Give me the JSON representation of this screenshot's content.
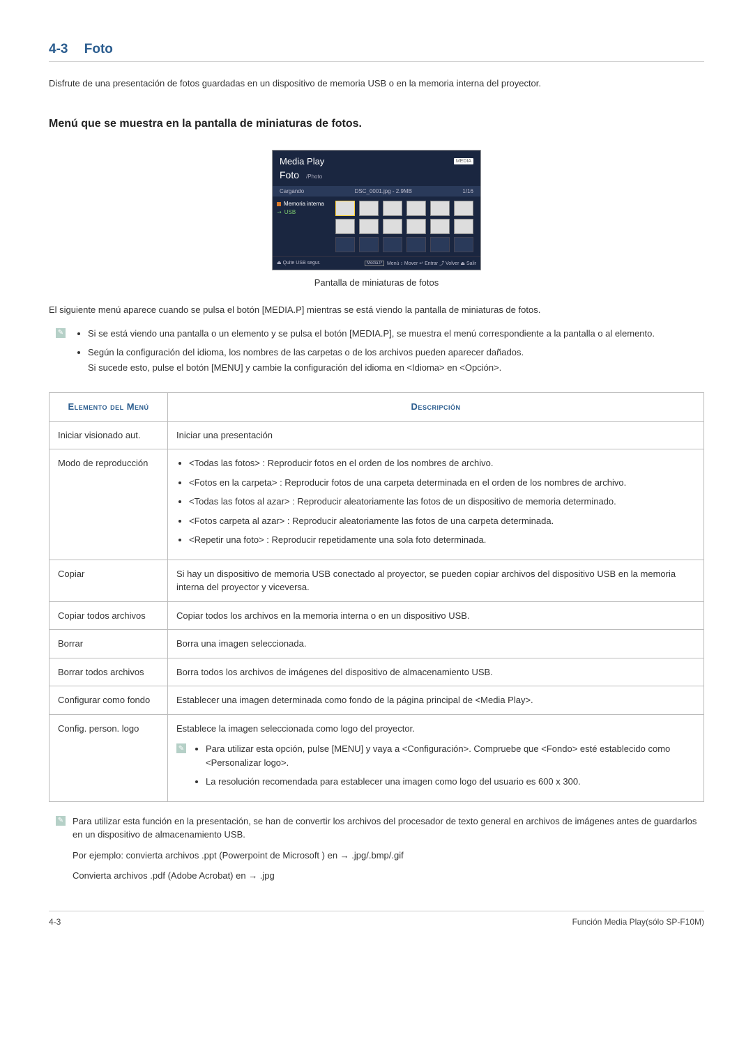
{
  "heading": {
    "num": "4-3",
    "title": "Foto"
  },
  "intro": "Disfrute de una presentación de fotos guardadas en un dispositivo de memoria USB o en la memoria interna del proyector.",
  "sub1": "Menú que se muestra en la pantalla de miniaturas de fotos.",
  "figure": {
    "title": "Media Play",
    "subtitle": "Foto",
    "path": "/Photo",
    "logo": "MEDIA",
    "status_left": "Cargando",
    "status_file": "DSC_0001.jpg - 2.9MB",
    "status_count": "1/16",
    "side_internal": "Memoria interna",
    "side_usb": "USB",
    "footer_left": "Quite USB segur.",
    "footer_mediap": "Media.P",
    "footer_right": "Menú  ↕ Mover  ↵ Entrar  ⤴ Volver  ⏏ Salir",
    "caption": "Pantalla de miniaturas de fotos"
  },
  "after_figure": "El siguiente menú aparece cuando se pulsa el botón [MEDIA.P] mientras se está viendo la pantalla de miniaturas de fotos.",
  "note1": {
    "b1": "Si se está viendo una pantalla o un elemento y se pulsa el botón [MEDIA.P], se muestra el menú correspondiente a la pantalla o al elemento.",
    "b2a": "Según la configuración del idioma, los nombres de las carpetas o de los archivos pueden aparecer dañados.",
    "b2b": "Si sucede esto, pulse el botón [MENU] y cambie la configuración del idioma en <Idioma> en <Opción>."
  },
  "table": {
    "h1": "Elemento del Menú",
    "h2": "Descripción",
    "r1_label": "Iniciar visionado aut.",
    "r1_desc": "Iniciar una presentación",
    "r2_label": "Modo de reproducción",
    "r2_b1": "<Todas las fotos> : Reproducir fotos en el orden de los nombres de archivo.",
    "r2_b2": "<Fotos en la carpeta> : Reproducir fotos de una carpeta determinada en el orden de los nombres de archivo.",
    "r2_b3": "<Todas las fotos al azar> : Reproducir aleatoriamente las fotos de un dispositivo de memoria determinado.",
    "r2_b4": "<Fotos carpeta al azar> : Reproducir aleatoriamente las fotos de una carpeta determinada.",
    "r2_b5": "<Repetir una foto> : Reproducir repetidamente una sola foto determinada.",
    "r3_label": "Copiar",
    "r3_desc": "Si hay un dispositivo de memoria USB conectado al proyector, se pueden copiar archivos del dispositivo USB en la memoria interna del proyector y viceversa.",
    "r4_label": "Copiar todos archivos",
    "r4_desc": "Copiar todos los archivos en la memoria interna o en un dispositivo USB.",
    "r5_label": "Borrar",
    "r5_desc": "Borra una imagen seleccionada.",
    "r6_label": "Borrar todos archivos",
    "r6_desc": "Borra todos los archivos de imágenes del dispositivo de almacenamiento USB.",
    "r7_label": "Configurar como fondo",
    "r7_desc": "Establecer una imagen determinada como fondo de la página principal de <Media Play>.",
    "r8_label": "Config. person. logo",
    "r8_desc": "Establece la imagen seleccionada como logo del proyector.",
    "r8_n1": "Para utilizar esta opción, pulse [MENU] y vaya a <Configuración>. Compruebe que <Fondo> esté establecido como <Personalizar logo>.",
    "r8_n2": "La resolución recomendada para establecer una imagen como logo del usuario es 600 x 300."
  },
  "post_note": {
    "p1": "Para utilizar esta función en la presentación, se han de convertir los archivos del procesador de texto general en archivos de imágenes antes de guardarlos en un dispositivo de almacenamiento USB.",
    "p2": "Por ejemplo: convierta archivos .ppt (Powerpoint de Microsoft ) en → .jpg/.bmp/.gif",
    "p3": "Convierta archivos .pdf (Adobe Acrobat) en → .jpg"
  },
  "footer": {
    "left": "4-3",
    "right": "Función Media Play(sólo SP-F10M)"
  }
}
